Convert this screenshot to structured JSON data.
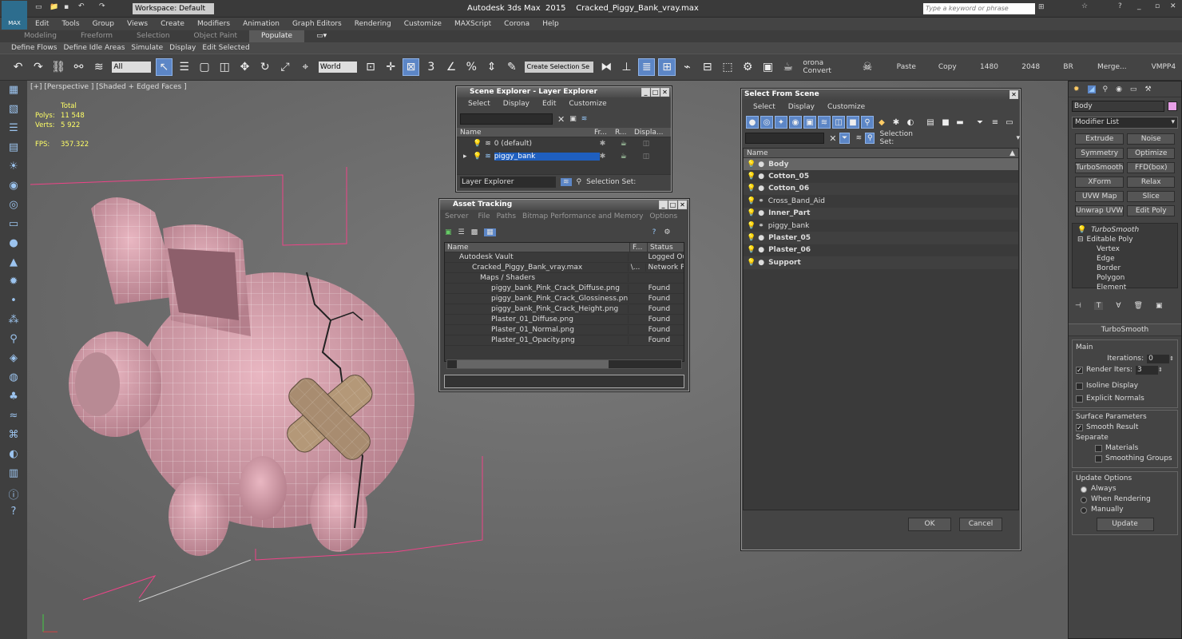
{
  "title": "Autodesk 3ds Max  2015    Cracked_Piggy_Bank_vray.max",
  "workspace": "Workspace: Default",
  "search_placeholder": "Type a keyword or phrase",
  "menu": [
    "Edit",
    "Tools",
    "Group",
    "Views",
    "Create",
    "Modifiers",
    "Animation",
    "Graph Editors",
    "Rendering",
    "Customize",
    "MAXScript",
    "Corona",
    "Help"
  ],
  "ribbon_tabs": [
    "Modeling",
    "Freeform",
    "Selection",
    "Object Paint",
    "Populate"
  ],
  "ribbon_row": [
    "Define Flows",
    "Define Idle Areas",
    "Simulate",
    "Display",
    "Edit Selected"
  ],
  "toolbar": {
    "filter": "All",
    "coord": "World",
    "selection_set": "Create Selection Se",
    "corona": "orona Convert",
    "paste": "Paste",
    "copy": "Copy",
    "w": "1480",
    "h": "2048",
    "br": "BR",
    "merge": "Merge...",
    "vmpp": "VMPP4"
  },
  "viewport": {
    "label": "[+] [Perspective ] [Shaded + Edged Faces ]",
    "total": "Total",
    "polys_label": "Polys:",
    "polys": "11 548",
    "verts_label": "Verts:",
    "verts": "5 922",
    "fps_label": "FPS:",
    "fps": "357.322"
  },
  "scene_explorer": {
    "title": "Scene Explorer - Layer Explorer",
    "menu": [
      "Select",
      "Display",
      "Edit",
      "Customize"
    ],
    "cols": [
      "Name",
      "Fr...",
      "R...",
      "Displa..."
    ],
    "rows": [
      "0 (default)",
      "piggy_bank"
    ],
    "footer_dd": "Layer Explorer",
    "footer_sel": "Selection Set:"
  },
  "asset_tracking": {
    "title": "Asset Tracking",
    "menu": [
      "Server",
      "File",
      "Paths",
      "Bitmap Performance and Memory",
      "Options"
    ],
    "cols": [
      "Name",
      "F...",
      "Status"
    ],
    "rows": [
      {
        "name": "Autodesk Vault",
        "f": "",
        "status": "Logged Out"
      },
      {
        "name": "Cracked_Piggy_Bank_vray.max",
        "f": "\\...",
        "status": "Network Pat"
      },
      {
        "name": "Maps / Shaders",
        "f": "",
        "status": ""
      },
      {
        "name": "piggy_bank_Pink_Crack_Diffuse.png",
        "f": "",
        "status": "Found"
      },
      {
        "name": "piggy_bank_Pink_Crack_Glossiness.png",
        "f": "",
        "status": "Found"
      },
      {
        "name": "piggy_bank_Pink_Crack_Height.png",
        "f": "",
        "status": "Found"
      },
      {
        "name": "Plaster_01_Diffuse.png",
        "f": "",
        "status": "Found"
      },
      {
        "name": "Plaster_01_Normal.png",
        "f": "",
        "status": "Found"
      },
      {
        "name": "Plaster_01_Opacity.png",
        "f": "",
        "status": "Found"
      }
    ]
  },
  "select_scene": {
    "title": "Select From Scene",
    "menu": [
      "Select",
      "Display",
      "Customize"
    ],
    "sel_set": "Selection Set:",
    "col": "Name",
    "items": [
      "Body",
      "Cotton_05",
      "Cotton_06",
      "Cross_Band_Aid",
      "Inner_Part",
      "piggy_bank",
      "Plaster_05",
      "Plaster_06",
      "Support"
    ],
    "ok": "OK",
    "cancel": "Cancel"
  },
  "cmd": {
    "name": "Body",
    "modlist": "Modifier List",
    "buttons": [
      "Extrude",
      "Noise",
      "Symmetry",
      "Optimize",
      "TurboSmooth",
      "FFD(box)",
      "XForm",
      "Relax",
      "UVW Map",
      "Slice",
      "Unwrap UVW",
      "Edit Poly"
    ],
    "stack": [
      "TurboSmooth",
      "Editable Poly",
      "Vertex",
      "Edge",
      "Border",
      "Polygon",
      "Element"
    ],
    "ts_title": "TurboSmooth",
    "main": "Main",
    "iter_label": "Iterations:",
    "iter": "0",
    "render_iters": "Render Iters:",
    "render_val": "3",
    "isoline": "Isoline Display",
    "explicit": "Explicit Normals",
    "surface": "Surface Parameters",
    "smooth": "Smooth Result",
    "separate": "Separate",
    "materials": "Materials",
    "smoothing": "Smoothing Groups",
    "update_opts": "Update Options",
    "always": "Always",
    "when_rendering": "When Rendering",
    "manually": "Manually",
    "update": "Update"
  }
}
